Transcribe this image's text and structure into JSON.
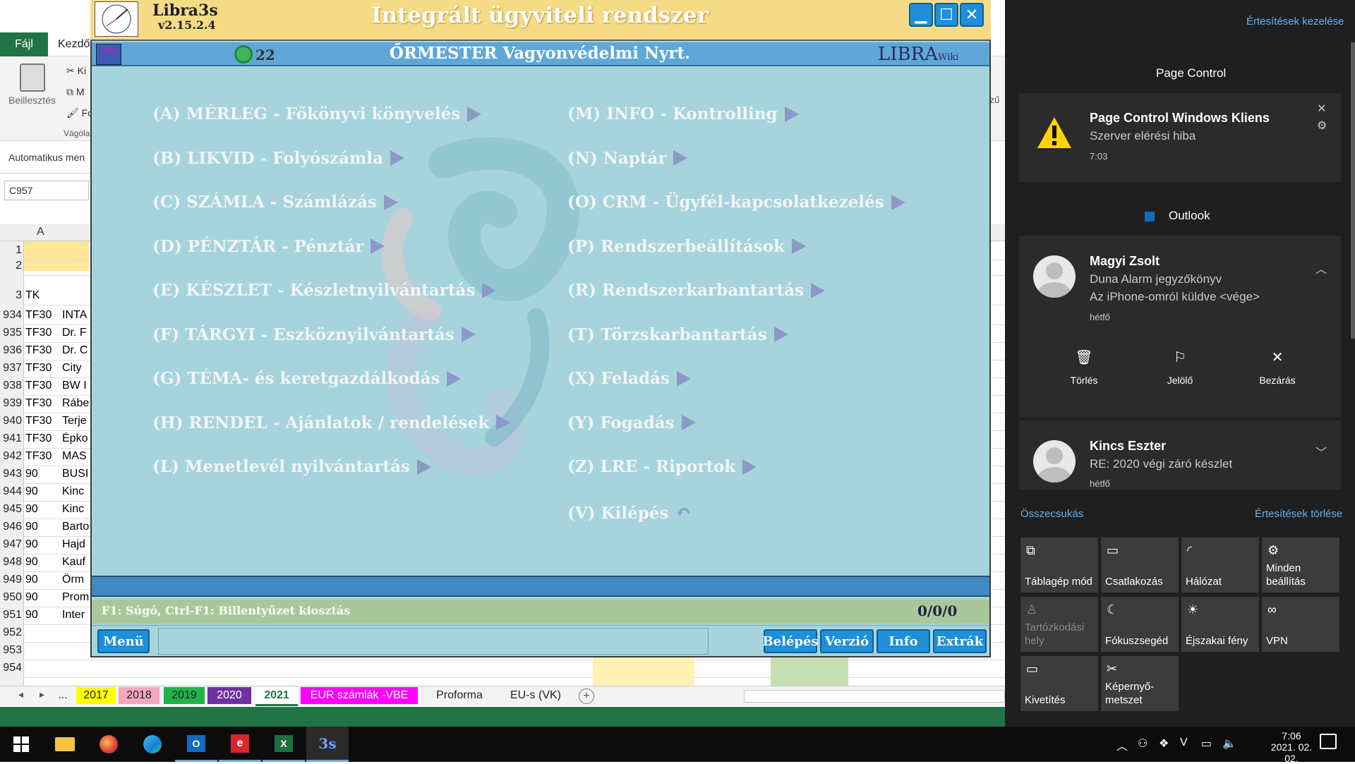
{
  "excel": {
    "file_tab": "Fájl",
    "home_tab": "Kezdő",
    "paste_label": "Beillesztés",
    "clipboard_label": "Vágólap",
    "ribbon_k": "Ki",
    "ribbon_m": "M",
    "ribbon_f": "Fo",
    "autosave": "Automatikus men",
    "namebox": "C957",
    "col_a": "A",
    "header_cell": "TK",
    "right_cut": "szű",
    "rows": [
      {
        "n": "1",
        "a": "",
        "b": ""
      },
      {
        "n": "2",
        "a": "",
        "b": ""
      },
      {
        "n": "3",
        "a": "TK",
        "b": ""
      },
      {
        "n": "934",
        "a": "TF30",
        "b": "INTA"
      },
      {
        "n": "935",
        "a": "TF30",
        "b": "Dr. F"
      },
      {
        "n": "936",
        "a": "TF30",
        "b": "Dr. C"
      },
      {
        "n": "937",
        "a": "TF30",
        "b": "City"
      },
      {
        "n": "938",
        "a": "TF30",
        "b": "BW I"
      },
      {
        "n": "939",
        "a": "TF30",
        "b": "Rábe"
      },
      {
        "n": "940",
        "a": "TF30",
        "b": "Terje"
      },
      {
        "n": "941",
        "a": "TF30",
        "b": "Épko"
      },
      {
        "n": "942",
        "a": "TF30",
        "b": "MAS"
      },
      {
        "n": "943",
        "a": "90",
        "b": "BUSI"
      },
      {
        "n": "944",
        "a": "90",
        "b": "Kinc"
      },
      {
        "n": "945",
        "a": "90",
        "b": "Kinc"
      },
      {
        "n": "946",
        "a": "90",
        "b": "Barto"
      },
      {
        "n": "947",
        "a": "90",
        "b": "Hajd"
      },
      {
        "n": "948",
        "a": "90",
        "b": "Kauf"
      },
      {
        "n": "949",
        "a": "90",
        "b": "Örm"
      },
      {
        "n": "950",
        "a": "90",
        "b": "Prom"
      },
      {
        "n": "951",
        "a": "90",
        "b": "Inter"
      },
      {
        "n": "952",
        "a": "",
        "b": ""
      },
      {
        "n": "953",
        "a": "",
        "b": ""
      },
      {
        "n": "954",
        "a": "",
        "b": ""
      }
    ],
    "sheets": [
      {
        "label": "...",
        "bg": "#f3f3f3",
        "fg": "#222"
      },
      {
        "label": "2017",
        "bg": "#ffff00",
        "fg": "#222"
      },
      {
        "label": "2018",
        "bg": "#f4a6c0",
        "fg": "#222"
      },
      {
        "label": "2019",
        "bg": "#1fb34a",
        "fg": "#222"
      },
      {
        "label": "2020",
        "bg": "#7030a0",
        "fg": "#fff"
      },
      {
        "label": "2021",
        "bg": "#ffffff",
        "fg": "#217346"
      },
      {
        "label": "EUR számlák -VBE",
        "bg": "#ff00ff",
        "fg": "#fff"
      },
      {
        "label": "Proforma",
        "bg": "#f3f3f3",
        "fg": "#222"
      },
      {
        "label": "EU-s (VK)",
        "bg": "#f3f3f3",
        "fg": "#222"
      }
    ]
  },
  "libra": {
    "brand": "Libra3s",
    "version": "v2.15.2.4",
    "app_title": "Integrált ügyviteli rendszer",
    "number": "22",
    "company": "ŐRMESTER Vagyonvédelmi Nyrt.",
    "wiki_logo": "LIBRA",
    "wiki_small": "Wiki",
    "menu_left": [
      "(A) MÉRLEG - Főkönyvi könyvelés",
      "(B) LIKVID - Folyószámla",
      "(C) SZÁMLA - Számlázás",
      "(D) PÉNZTÁR - Pénztár",
      "(E) KÉSZLET - Készletnyilvántartás",
      "(F) TÁRGYI - Eszköznyilvántartás",
      "(G) TÉMA- és keretgazdálkodás",
      "(H) RENDEL - Ajánlatok / rendelések",
      "(L) Menetlevél nyilvántartás"
    ],
    "menu_right": [
      "(M) INFO - Kontrolling",
      "(N) Naptár",
      "(O) CRM - Ügyfél-kapcsolatkezelés",
      "(P) Rendszerbeállítások",
      "(R) Rendszerkarbantartás",
      "(T) Törzskarbantartás",
      "(X) Feladás",
      "(Y) Fogadás",
      "(Z) LRE - Riportok"
    ],
    "exit_label": "(V) Kilépés",
    "help_text": "F1: Súgó, Ctrl-F1: Billentyűzet kiosztás",
    "counter": "0/0/0",
    "menu_button": "Menü",
    "buttons": [
      "Belépés",
      "Verzió",
      "Info",
      "Extrák"
    ]
  },
  "notifications": {
    "manage_link": "Értesítések kezelése",
    "page_control_header": "Page Control",
    "pc_title": "Page Control Windows Kliens",
    "pc_body": "Szerver elérési hiba",
    "pc_time": "7:03",
    "outlook_header": "Outlook",
    "mail1": {
      "sender": "Magyi Zsolt",
      "subject": "Duna Alarm jegyzőkönyv",
      "body": "Az iPhone-omról küldve <vége>",
      "time": "hétfő"
    },
    "mail_actions": [
      "Törlés",
      "Jelölő",
      "Bezárás"
    ],
    "mail2": {
      "sender": "Kincs Eszter",
      "subject": "RE: 2020 végi záró készlet",
      "time": "hétfő"
    },
    "collapse_link": "Összecsukás",
    "clear_link": "Értesítések törlése",
    "quick_actions": [
      {
        "label": "Táblagép mód",
        "icon": "⧉"
      },
      {
        "label": "Csatlakozás",
        "icon": "▭"
      },
      {
        "label": "Hálózat",
        "icon": "◜"
      },
      {
        "label": "Minden beállítás",
        "icon": "⚙"
      },
      {
        "label": "Tartózkodási hely",
        "icon": "♙"
      },
      {
        "label": "Fókuszsegéd",
        "icon": "☾"
      },
      {
        "label": "Éjszakai fény",
        "icon": "☀"
      },
      {
        "label": "VPN",
        "icon": "∞"
      },
      {
        "label": "Kivetítés",
        "icon": "▭"
      },
      {
        "label": "Képernyő-metszet",
        "icon": "✂"
      }
    ]
  },
  "taskbar": {
    "time": "7:06",
    "date": "2021. 02. 02."
  }
}
